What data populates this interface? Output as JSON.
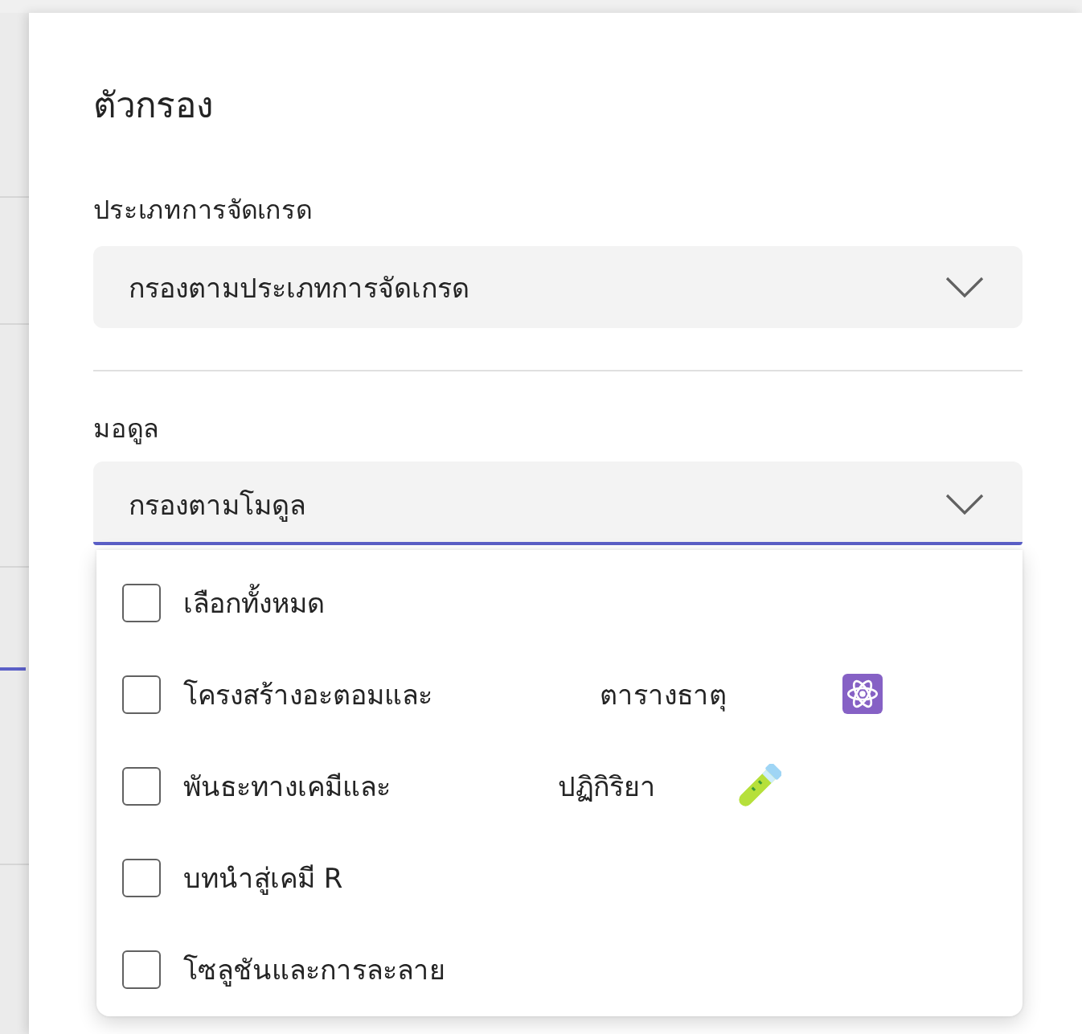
{
  "panel": {
    "title": "ตัวกรอง",
    "filters": [
      {
        "label": "ประเภทการจัดเกรด",
        "text": "กรองตามประเภทการจัดเกรด",
        "expanded": false
      },
      {
        "label": "มอดูล",
        "text": "กรองตามโมดูล",
        "expanded": true,
        "options": [
          {
            "kind": "plain",
            "parts": [
              "เลือกทั้งหมด"
            ],
            "checked": false
          },
          {
            "kind": "icon",
            "parts": [
              "โครงสร้างอะตอมและ",
              "ตารางธาตุ"
            ],
            "checked": false
          },
          {
            "kind": "icon",
            "parts": [
              "พันธะทางเคมีและ",
              "ปฏิกิริยา"
            ],
            "checked": false
          },
          {
            "kind": "plain",
            "parts": [
              "บทนำสู่เคมี R"
            ],
            "checked": false
          },
          {
            "kind": "plain",
            "parts": [
              "โซลูชันและการละลาย"
            ],
            "checked": false
          }
        ]
      }
    ]
  }
}
